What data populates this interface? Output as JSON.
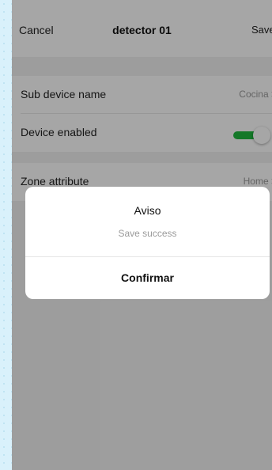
{
  "nav": {
    "cancel_label": "Cancel",
    "title": "detector 01",
    "save_label": "Save"
  },
  "rows": [
    {
      "label": "Sub device name",
      "value": "Cocina >"
    },
    {
      "label": "Device enabled",
      "toggle_on": true
    },
    {
      "label": "Zone attribute",
      "value": "Home >"
    }
  ],
  "dialog": {
    "title": "Aviso",
    "message": "Save success",
    "confirm_label": "Confirmar"
  },
  "colors": {
    "toggle_on": "#1fb93e",
    "page_bg": "#f2f2f2",
    "outer_bg": "#d9f1fb"
  }
}
